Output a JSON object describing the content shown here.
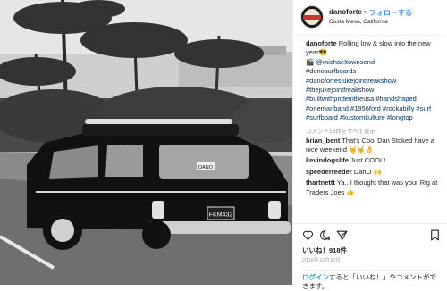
{
  "post": {
    "username": "danoforte",
    "follow_label": "フォローする",
    "separator": "•",
    "location": "Costa Mesa, California",
    "caption": {
      "author": "danoforte",
      "text": "Rolling low & slow into the new year😎",
      "mention_line": "🎬 @michaeltownsend",
      "hashtags": [
        "#danosurfboards",
        "#danofortesjukejointfreakshow",
        "#thejukejointfreakshow",
        "#builtwithprideintheusa #handshaped",
        "#onemanband #1956ford #rockabilly #surf",
        "#surfboard #kustomkulture #longtop"
      ]
    },
    "view_all_comments": "コメント18件をすべて表示",
    "comments": [
      {
        "user": "brian_bent",
        "text": "That's Cool Dan Stoked have a nice weekend 🤘🤘👌"
      },
      {
        "user": "kevindogslife",
        "text": "Just COOL!"
      },
      {
        "user": "speederreeder",
        "text": "DanO 🙌"
      },
      {
        "user": "thartnettt",
        "text": "Ya.. I thought that was your Rig at Traders Joes 🤙"
      }
    ],
    "likes": "いいね！918件",
    "date": "2018年12月30日",
    "login_prompt": {
      "link": "ログイン",
      "rest": "すると「いいね！」やコメントができます。"
    },
    "plate": "FKM432",
    "bumper_sticker": "DANO"
  },
  "icons": {
    "like": "heart-icon",
    "comment": "comment-icon",
    "share": "share-icon",
    "save": "bookmark-icon"
  },
  "colors": {
    "link": "#3897f0",
    "hashtag": "#003569",
    "text": "#262626"
  }
}
